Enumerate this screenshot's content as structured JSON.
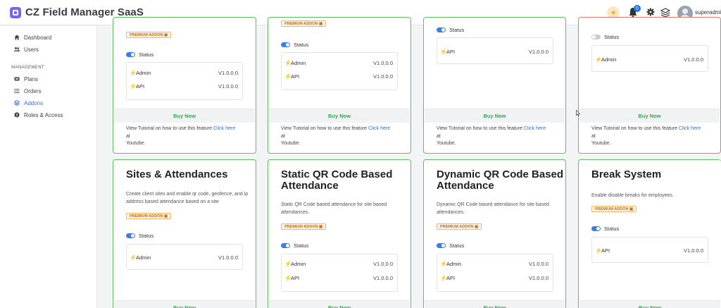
{
  "app": {
    "title": "CZ Field Manager SaaS"
  },
  "header": {
    "notification_count": "0",
    "username": "superadmin"
  },
  "sidebar": {
    "items": [
      {
        "label": "Dashboard"
      },
      {
        "label": "Users"
      }
    ],
    "section_title": "MANAGEMENT",
    "management_items": [
      {
        "label": "Plans"
      },
      {
        "label": "Orders"
      },
      {
        "label": "Addons"
      },
      {
        "label": "Roles & Access"
      }
    ]
  },
  "common": {
    "badge": "PREMIUM ADDON",
    "status_label": "Status",
    "buy_now": "Buy Now",
    "tutorial_prefix": "View Tutorial on how to use this feature ",
    "tutorial_link": "Click here",
    "tutorial_at": "at",
    "tutorial_suffix": "Youtube."
  },
  "top_cards": [
    {
      "versions": [
        {
          "name": "Admin",
          "version": "V1.0.0.0"
        },
        {
          "name": "API",
          "version": "V1.0.0.0"
        }
      ]
    },
    {
      "versions": [
        {
          "name": "Admin",
          "version": "V1.0.0.0"
        },
        {
          "name": "API",
          "version": "V1.0.0.0"
        }
      ]
    },
    {
      "versions": [
        {
          "name": "API",
          "version": "V1.0.0.0"
        }
      ]
    },
    {
      "versions": [
        {
          "name": "Admin",
          "version": "V1.0.0.0"
        }
      ]
    }
  ],
  "bottom_cards": [
    {
      "title": "Sites & Attendances",
      "description": "Create client sites and enable qr code, geofence, and ip address based attendance based on a site",
      "versions": [
        {
          "name": "Admin",
          "version": "V1.0.0.0"
        }
      ]
    },
    {
      "title": "Static QR Code Based Attendance",
      "description": "Static QR Code based attendance for site based attendances.",
      "versions": [
        {
          "name": "Admin",
          "version": "V1.0.0.0"
        },
        {
          "name": "API",
          "version": "V1.0.0.0"
        }
      ]
    },
    {
      "title": "Dynamic QR Code Based Attendance",
      "description": "Dynamic QR Code based attendance for site based attendances.",
      "versions": [
        {
          "name": "Admin",
          "version": "V1.0.0.0"
        },
        {
          "name": "API",
          "version": "V1.0.0.0"
        }
      ]
    },
    {
      "title": "Break System",
      "description": "Enable disable breaks for employees.",
      "versions": [
        {
          "name": "API",
          "version": "V1.0.0.0"
        }
      ]
    }
  ]
}
